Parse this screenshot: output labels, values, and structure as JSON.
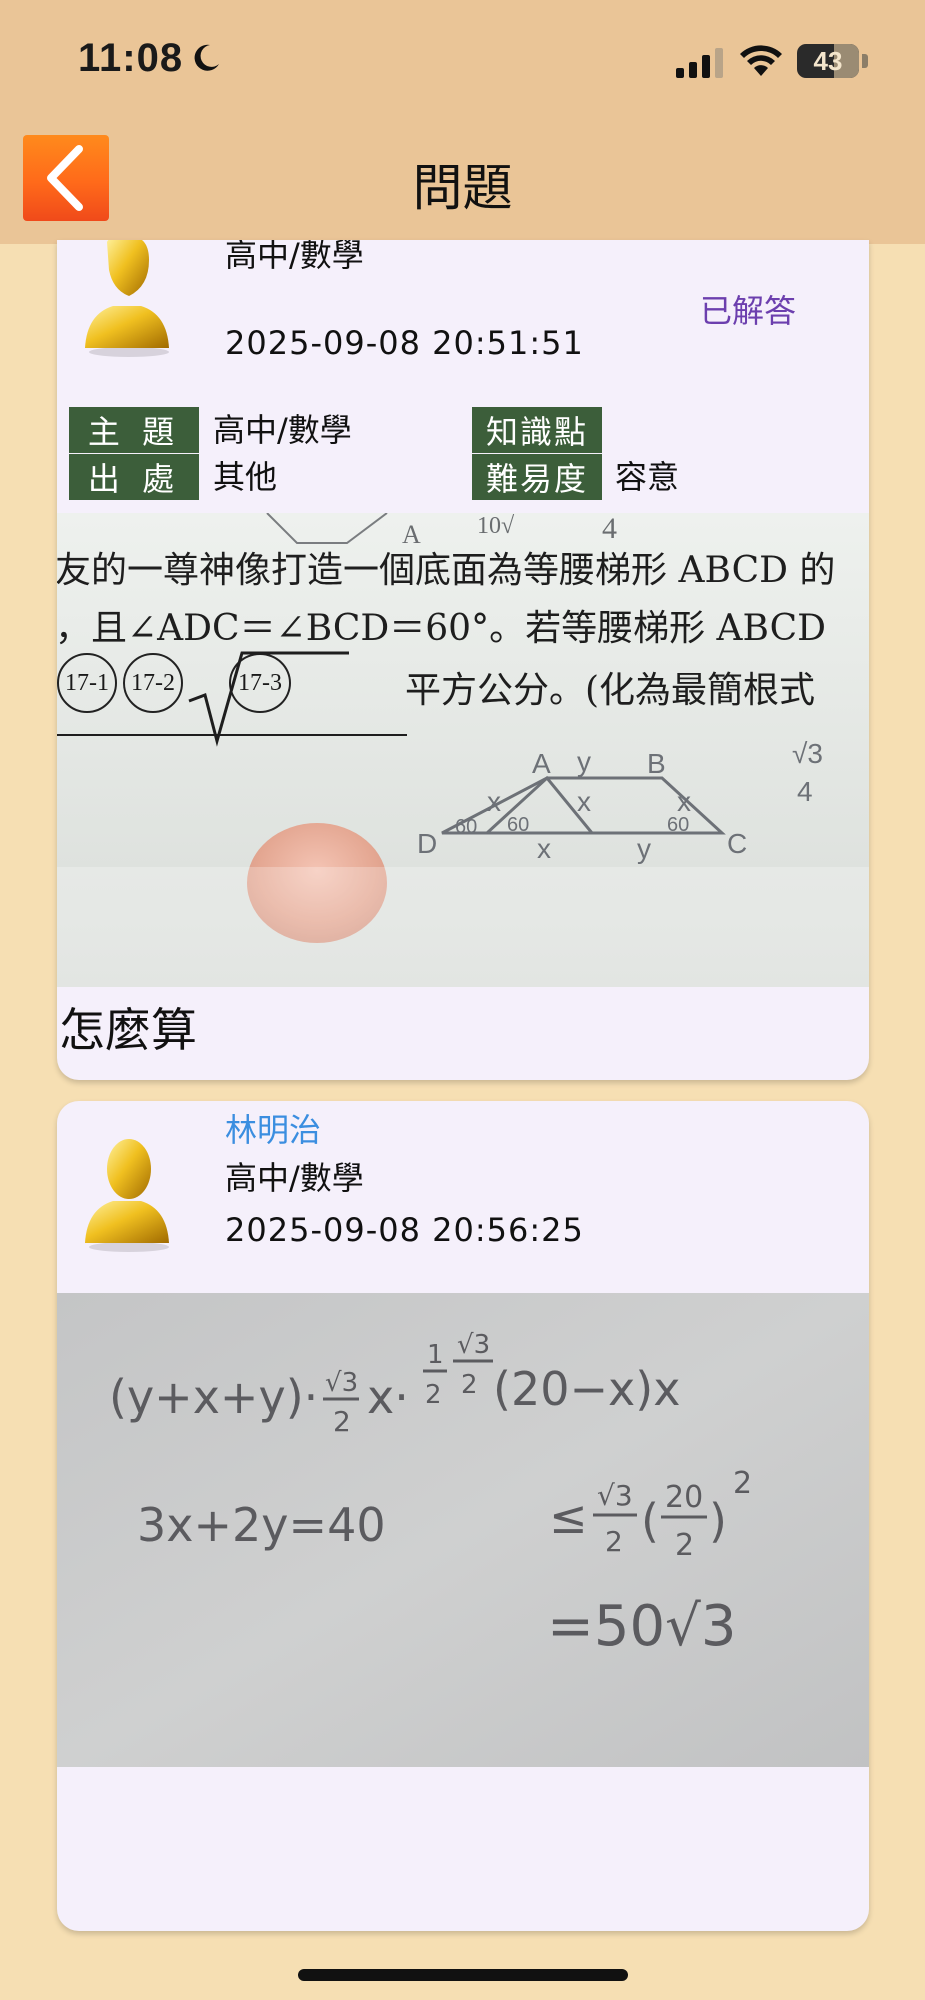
{
  "status_bar": {
    "time": "11:08",
    "battery": "43"
  },
  "nav": {
    "title": "問題"
  },
  "question_card": {
    "subject": "高中/數學",
    "datetime": "2025-09-08 20:51:51",
    "status": "已解答",
    "meta": {
      "topic_label": "主 題",
      "topic_value": "高中/數學",
      "source_label": "出 處",
      "source_value": "其他",
      "knowledge_label": "知識點",
      "knowledge_value": "",
      "difficulty_label": "難易度",
      "difficulty_value": "容意"
    },
    "photo": {
      "line1": "友的一尊神像打造一個底面為等腰梯形 ABCD 的",
      "line2": "，且∠ADC＝∠BCD＝60°。若等腰梯形 ABCD",
      "line3": "平方公分。(化為最簡根式",
      "bubbles": [
        "17-1",
        "17-2",
        "17-3"
      ]
    },
    "text": "怎麼算"
  },
  "answer_card": {
    "user": "林明治",
    "subject": "高中/數學",
    "datetime": "2025-09-08 20:56:25"
  },
  "colors": {
    "page_bg": "#f6dfb3",
    "header_bg": "#eac597",
    "card_bg": "#f5f0fb",
    "label_bg": "#3c5e3a",
    "status_purple": "#6c3fae",
    "user_blue": "#3b8ee0",
    "back_orange": "#ff6a1a"
  }
}
